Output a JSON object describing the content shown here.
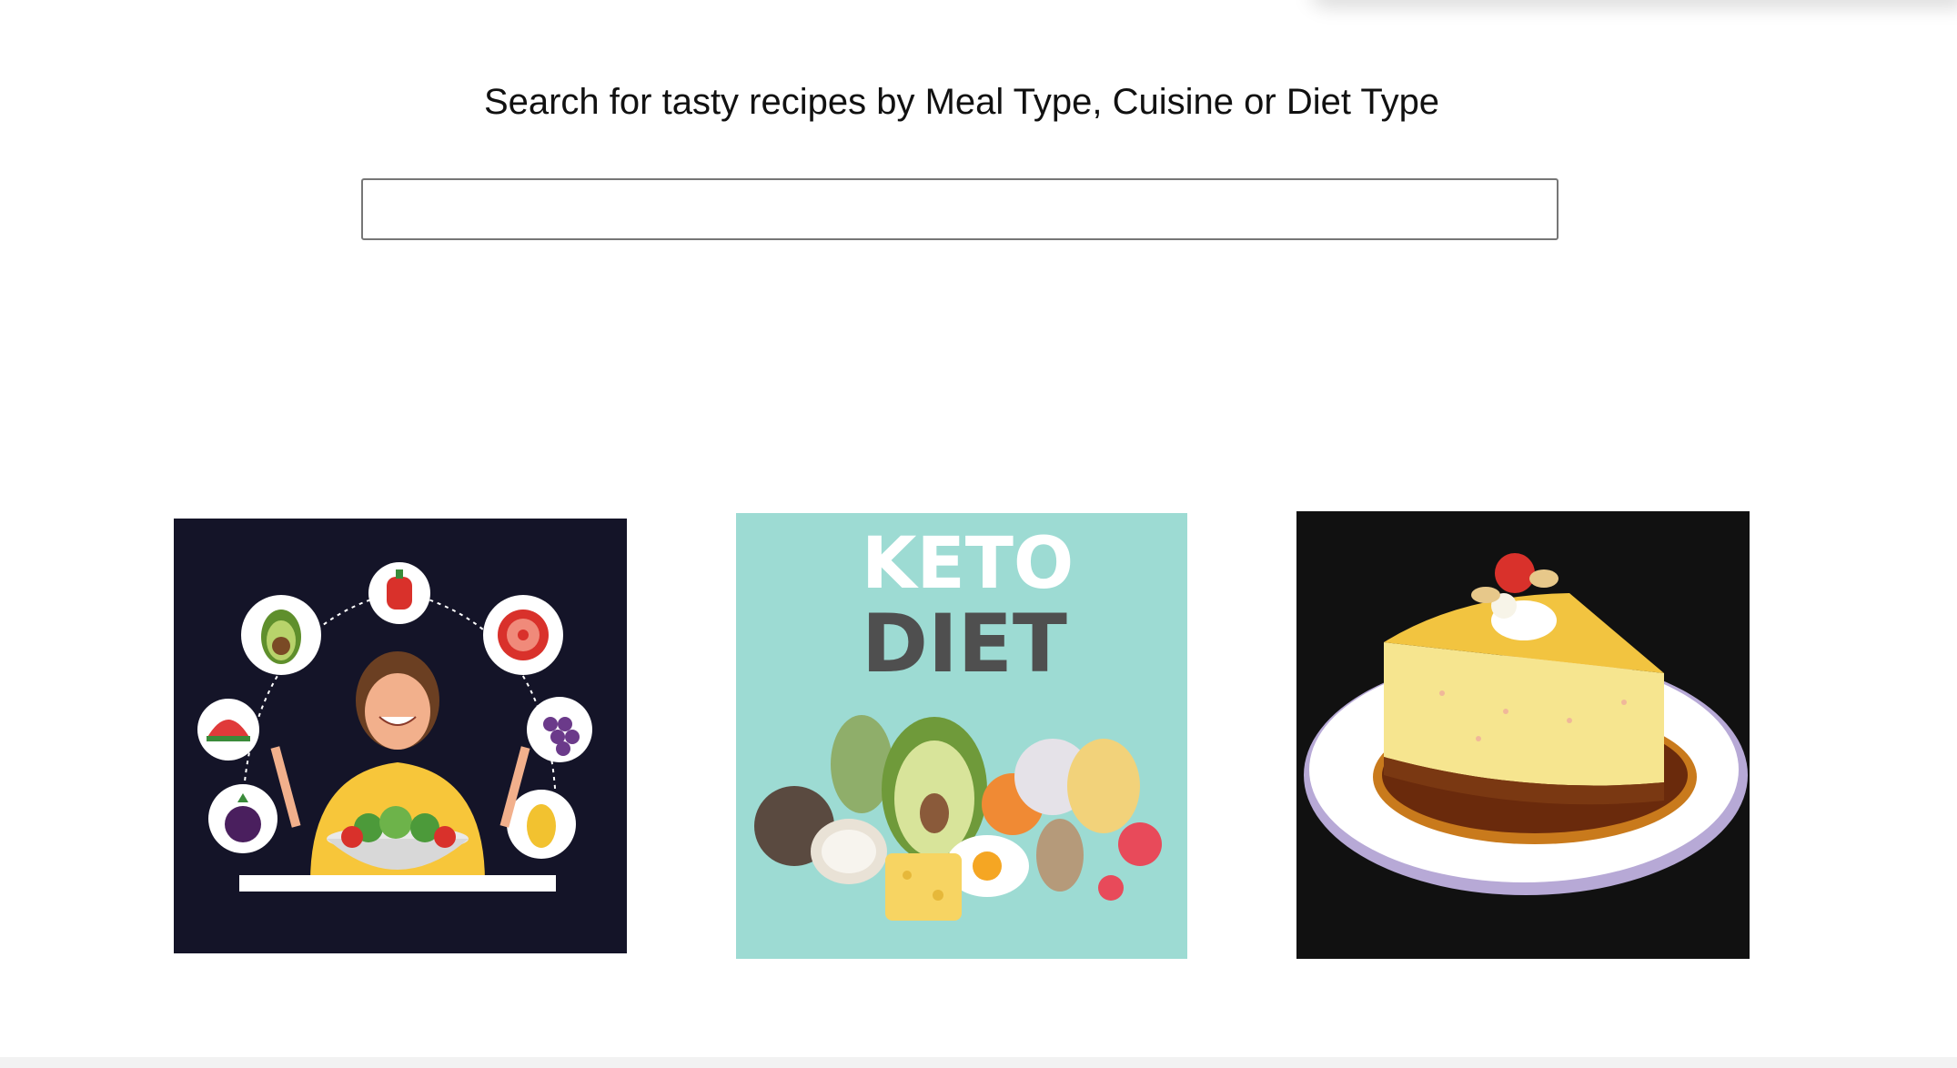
{
  "page": {
    "heading": "Search for tasty recipes by Meal Type, Cuisine or Diet Type"
  },
  "search": {
    "value": "",
    "placeholder": ""
  },
  "cards": [
    {
      "subject": "healthy-eating",
      "background": "#141428"
    },
    {
      "subject": "keto-diet",
      "background": "#9ddbd3",
      "title_line1": "KETO",
      "title_line2": "DIET"
    },
    {
      "subject": "dessert-cheesecake",
      "background": "#111111"
    }
  ],
  "colors": {
    "text": "#111111",
    "input_border": "#767676"
  }
}
